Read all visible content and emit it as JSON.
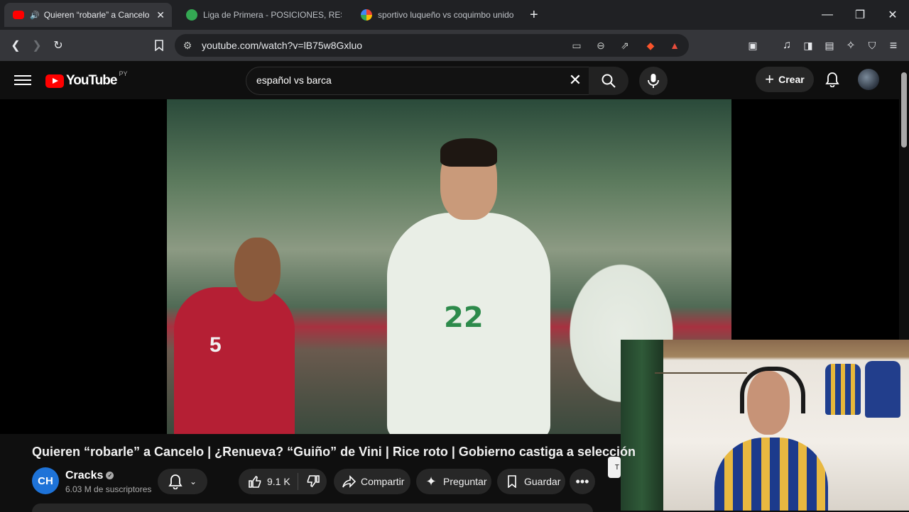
{
  "browser": {
    "tabs": [
      {
        "title": "Quieren “robarle” a Cancelo |",
        "favicon_color": "#ff0000",
        "active": true,
        "audio": true
      },
      {
        "title": "Liga de Primera - POSICIONES, RESU",
        "favicon_color": "#34a853",
        "active": false
      },
      {
        "title": "sportivo luqueño vs coquimbo unido",
        "favicon_color": "#ffffff",
        "active": false
      }
    ],
    "new_tab": "+",
    "url": "youtube.com/watch?v=lB75w8Gxluo"
  },
  "youtube": {
    "logo_text": "YouTube",
    "country_code": "PY",
    "search_query": "español vs barca",
    "create_label": "Crear"
  },
  "video": {
    "title": "Quieren “robarle” a Cancelo | ¿Renueva? “Guiño” de Vini | Rice roto | Gobierno castiga a selección",
    "player_number_front": "22",
    "player_number_left": "5",
    "channel": {
      "avatar_text": "CH",
      "name": "Cracks",
      "subscribers": "6.03 M de suscriptores"
    },
    "actions": {
      "likes": "9.1 K",
      "share": "Compartir",
      "ask": "Preguntar",
      "save": "Guardar"
    }
  },
  "colors": {
    "brand_red": "#ff0000",
    "background": "#0f0f0f",
    "chip": "#272727"
  }
}
